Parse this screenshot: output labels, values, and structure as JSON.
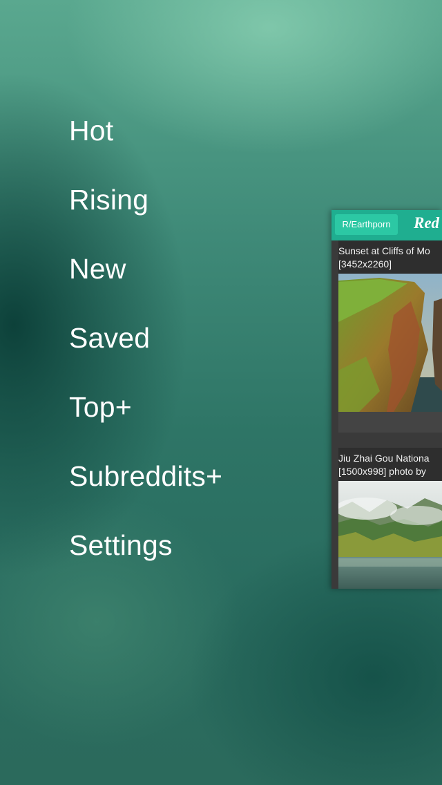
{
  "menu": {
    "items": [
      {
        "label": "Hot"
      },
      {
        "label": "Rising"
      },
      {
        "label": "New"
      },
      {
        "label": "Saved"
      },
      {
        "label": "Top+"
      },
      {
        "label": "Subreddits+"
      },
      {
        "label": "Settings"
      }
    ]
  },
  "preview": {
    "subreddit_button": "R/Earthporn",
    "logo": "Red",
    "posts": [
      {
        "title_line1": "Sunset at Cliffs of Mo",
        "title_line2": "[3452x2260]"
      },
      {
        "title_line1": "Jiu Zhai Gou Nationa",
        "title_line2": "[1500x998] photo by"
      }
    ]
  },
  "colors": {
    "accent": "#1fae90",
    "button": "#2cc8a4",
    "background_top": "#5aa88f",
    "background_dark": "#0b4a42"
  },
  "icons": []
}
